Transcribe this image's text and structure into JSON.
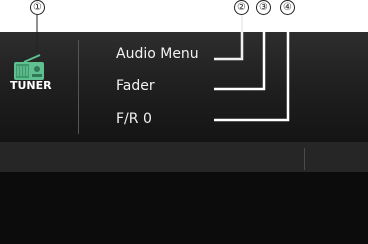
{
  "callouts": [
    "①",
    "②",
    "③",
    "④"
  ],
  "source": {
    "label": "TUNER",
    "icon": "radio-icon"
  },
  "menu": {
    "title": "Audio Menu",
    "item": "Fader",
    "value": "F/R 0"
  },
  "colors": {
    "icon_green": "#5fbf8e",
    "leader_line": "#ffffff",
    "background": "#0c0c0c"
  }
}
